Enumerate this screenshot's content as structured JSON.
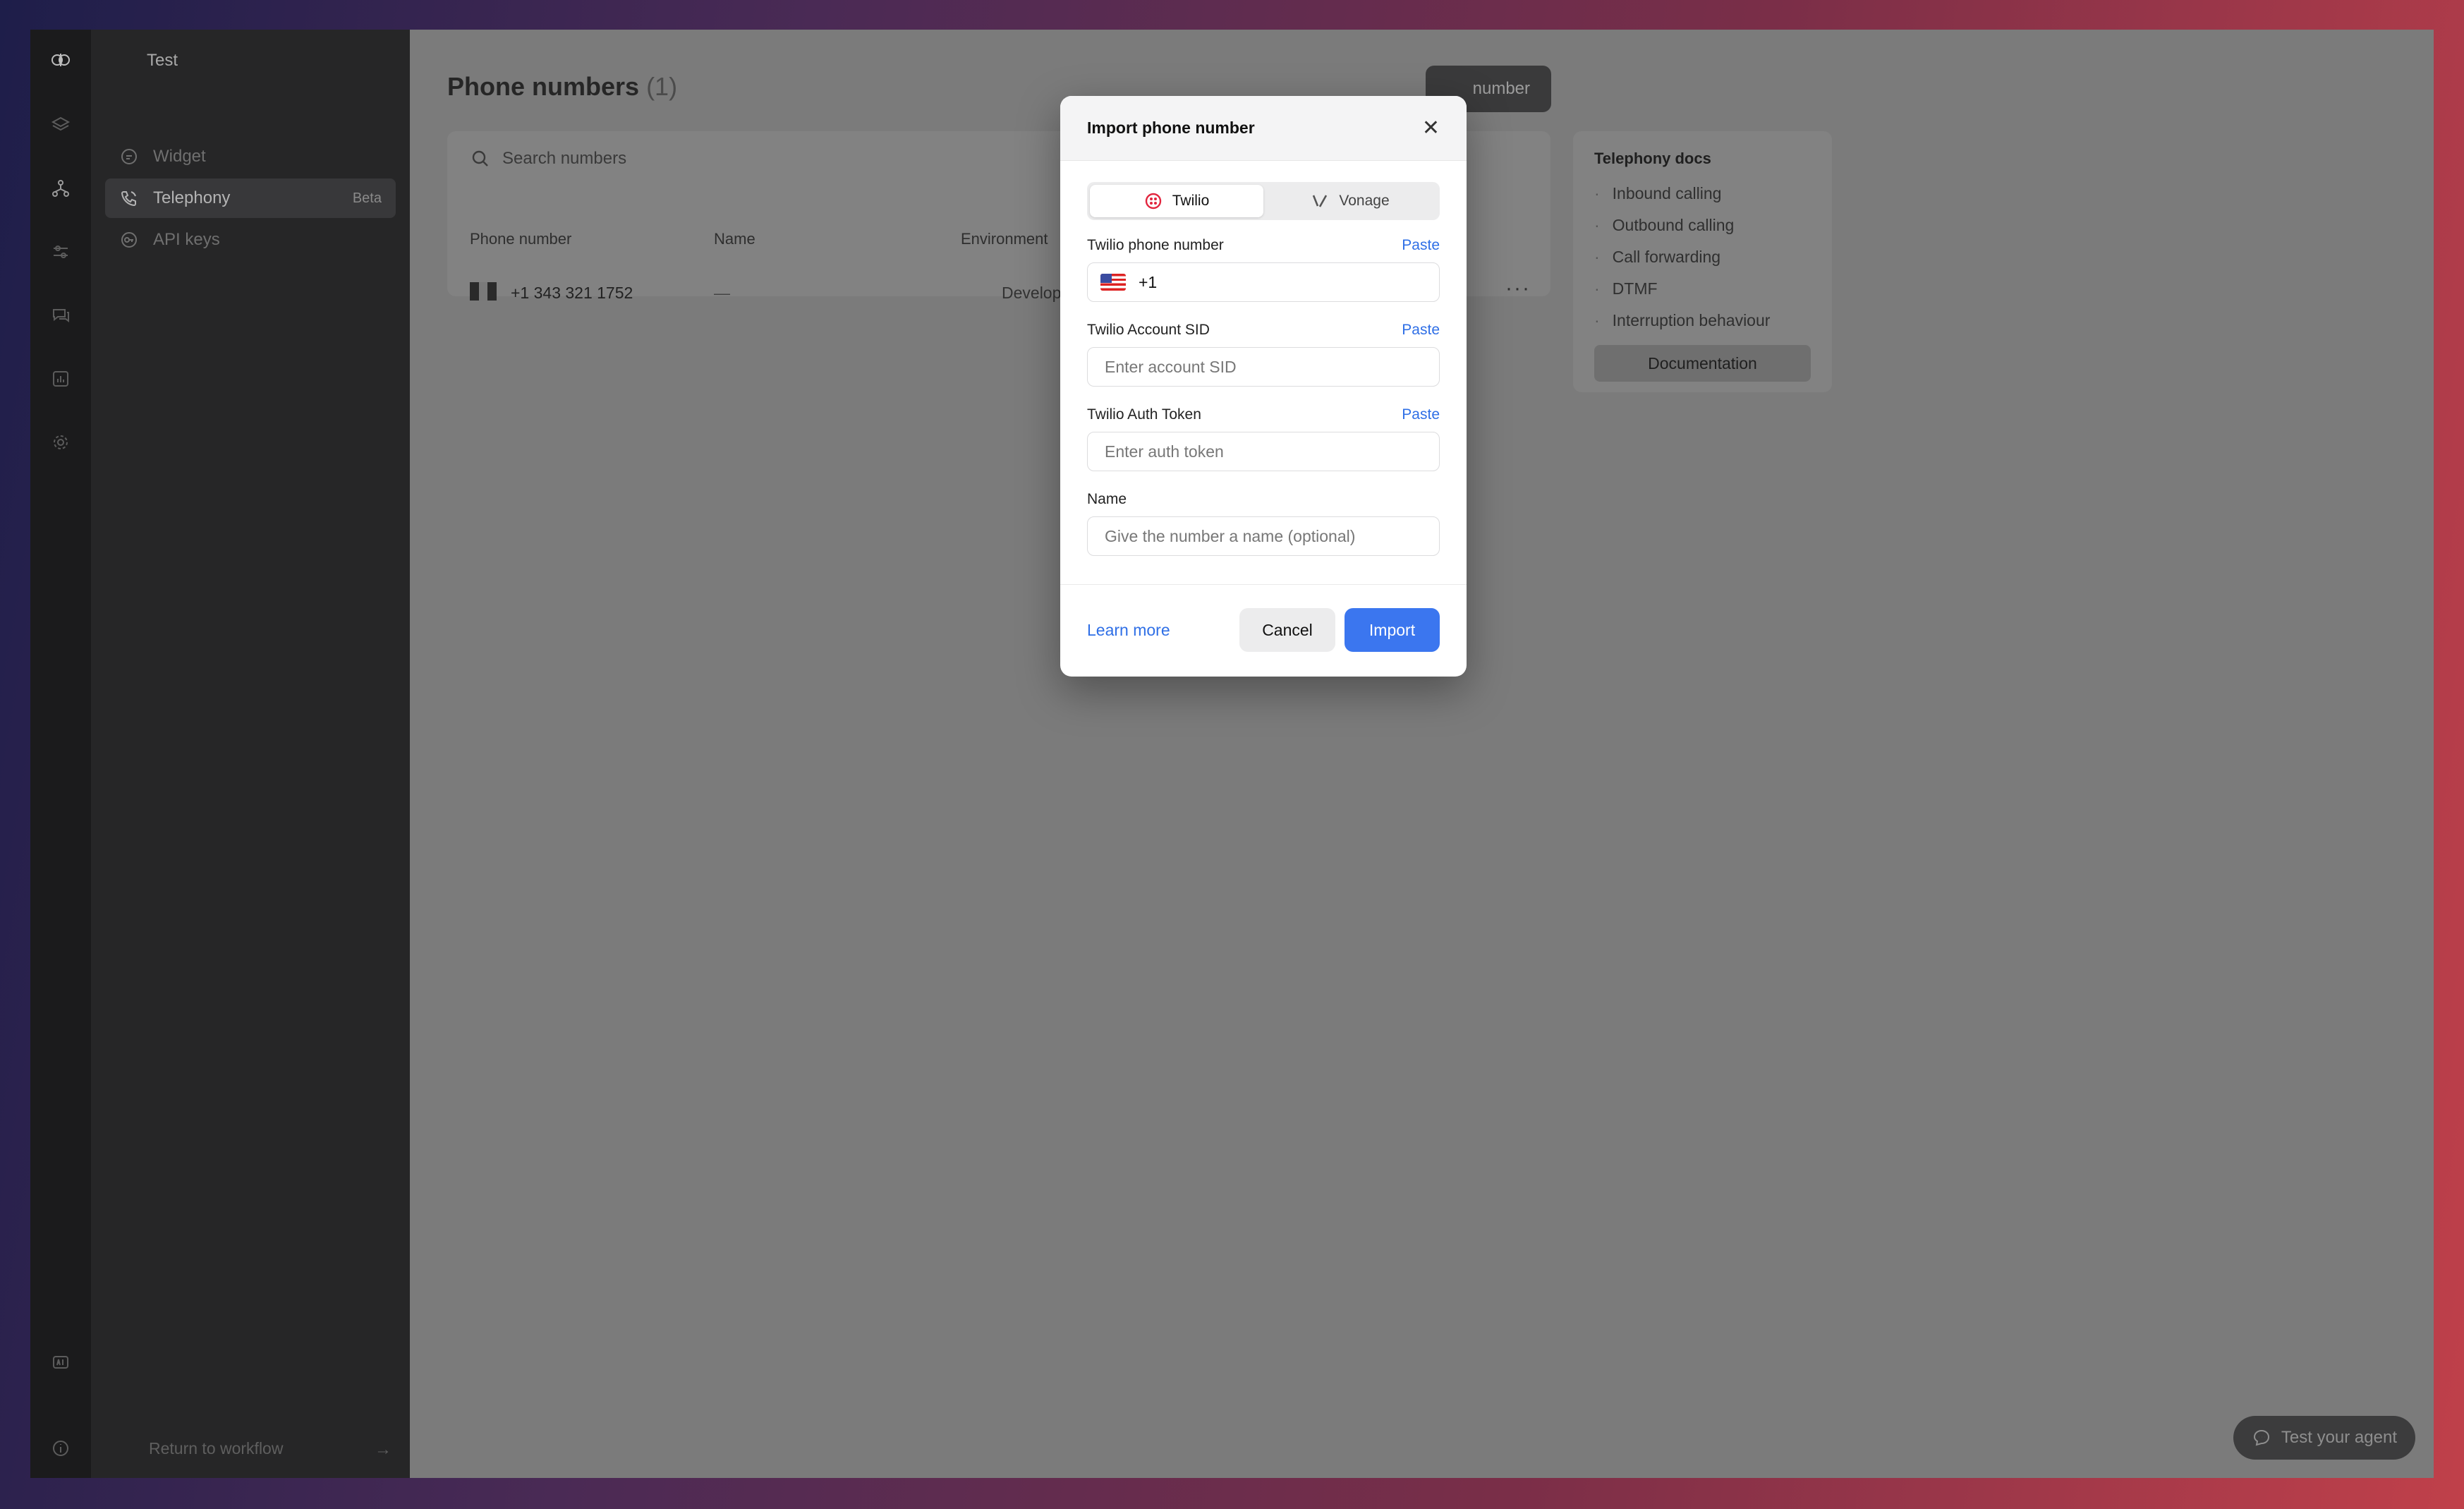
{
  "sidebar": {
    "workspace": "Test",
    "items": [
      {
        "label": "Widget",
        "icon": "widget-icon"
      },
      {
        "label": "Telephony",
        "icon": "phone-icon",
        "badge": "Beta",
        "active": true
      },
      {
        "label": "API keys",
        "icon": "key-icon"
      }
    ],
    "return_label": "Return to workflow"
  },
  "rail": {
    "icons": [
      "logo-icon",
      "layers-icon",
      "workflow-icon",
      "sliders-icon",
      "chat-icon",
      "analytics-icon",
      "settings-icon",
      "ai-icon",
      "info-icon"
    ]
  },
  "main": {
    "title": "Phone numbers",
    "count": "(1)",
    "import_button": "number",
    "search_placeholder": "Search numbers",
    "columns": [
      "Phone number",
      "Name",
      "Environment"
    ],
    "rows": [
      {
        "phone": "+1 343 321 1752",
        "name": "—",
        "environment": "Development"
      }
    ],
    "more_icon": "more-icon"
  },
  "docs": {
    "title": "Telephony docs",
    "links": [
      "Inbound calling",
      "Outbound calling",
      "Call forwarding",
      "DTMF",
      "Interruption behaviour"
    ],
    "button": "Documentation"
  },
  "test_agent": "Test your agent",
  "modal": {
    "title": "Import phone number",
    "providers": [
      "Twilio",
      "Vonage"
    ],
    "selected_provider": "Twilio",
    "fields": {
      "phone": {
        "label": "Twilio phone number",
        "paste": "Paste",
        "value": "+1"
      },
      "sid": {
        "label": "Twilio Account SID",
        "paste": "Paste",
        "placeholder": "Enter account SID"
      },
      "token": {
        "label": "Twilio Auth Token",
        "paste": "Paste",
        "placeholder": "Enter auth token"
      },
      "name": {
        "label": "Name",
        "placeholder": "Give the number a name (optional)"
      }
    },
    "learn_more": "Learn more",
    "cancel": "Cancel",
    "import": "Import"
  },
  "colors": {
    "accent": "#3b76ef",
    "link": "#2f6fe6",
    "twilio": "#e2253e"
  }
}
